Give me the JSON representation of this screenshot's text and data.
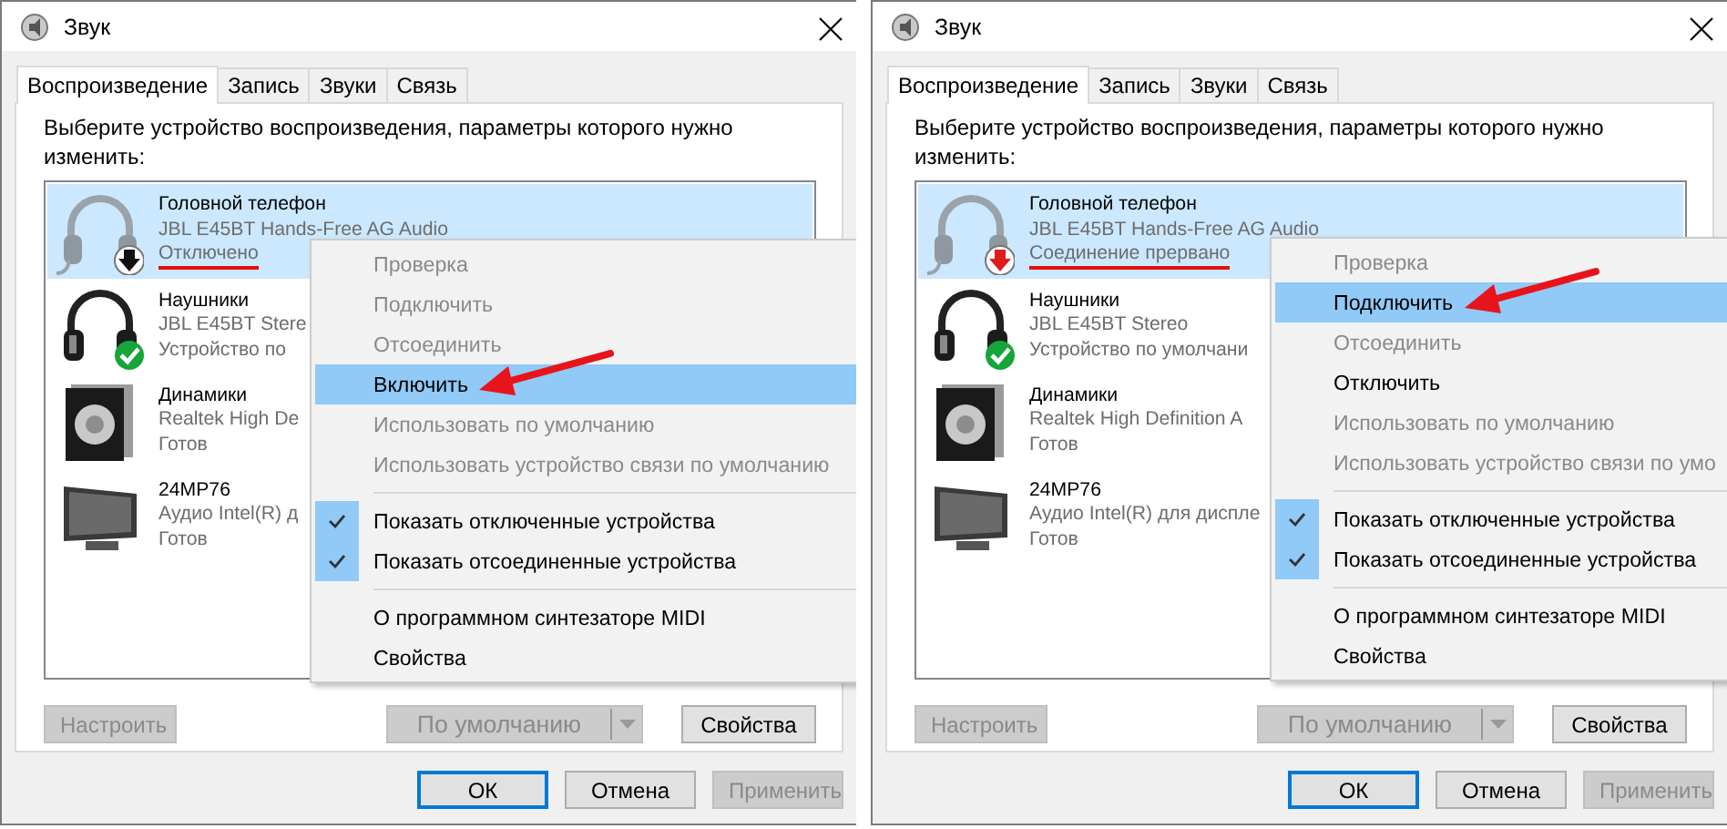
{
  "panels": [
    {
      "window": {
        "title": "Звук"
      },
      "tabs": [
        {
          "label": "Воспроизведение",
          "selected": true
        },
        {
          "label": "Запись",
          "selected": false
        },
        {
          "label": "Звуки",
          "selected": false
        },
        {
          "label": "Связь",
          "selected": false
        }
      ],
      "instruction": "Выберите устройство воспроизведения, параметры которого нужно изменить:",
      "devices": [
        {
          "kind": "off",
          "name": "Головной телефон",
          "driver": "JBL E45BT Hands-Free AG Audio",
          "status": "Отключено",
          "selected": true,
          "underlined": true
        },
        {
          "kind": "default",
          "name": "Наушники",
          "driver": "JBL E45BT Stere",
          "status": "Устройство по",
          "selected": false,
          "underlined": false
        },
        {
          "kind": "ready",
          "name": "Динамики",
          "driver": "Realtek High De",
          "status": "Готов",
          "selected": false,
          "underlined": false
        },
        {
          "kind": "ready",
          "name": "24MP76",
          "driver": "Аудио Intel(R) д",
          "status": "Готов",
          "selected": false,
          "underlined": false
        }
      ],
      "menu": [
        {
          "kind": "item",
          "label": "Проверка",
          "disabled": true,
          "selected": false,
          "checked": false,
          "pointed": false
        },
        {
          "kind": "item",
          "label": "Подключить",
          "disabled": true,
          "selected": false,
          "checked": false,
          "pointed": false
        },
        {
          "kind": "item",
          "label": "Отсоединить",
          "disabled": true,
          "selected": false,
          "checked": false,
          "pointed": false
        },
        {
          "kind": "item",
          "label": "Включить",
          "disabled": false,
          "selected": true,
          "checked": false,
          "pointed": true
        },
        {
          "kind": "item",
          "label": "Использовать по умолчанию",
          "disabled": true,
          "selected": false,
          "checked": false,
          "pointed": false
        },
        {
          "kind": "item",
          "label": "Использовать устройство связи по умолчанию",
          "disabled": true,
          "selected": false,
          "checked": false,
          "pointed": false
        },
        {
          "kind": "separator"
        },
        {
          "kind": "item",
          "label": "Показать отключенные устройства",
          "disabled": false,
          "selected": false,
          "checked": true,
          "pointed": false
        },
        {
          "kind": "item",
          "label": "Показать отсоединенные устройства",
          "disabled": false,
          "selected": false,
          "checked": true,
          "pointed": false
        },
        {
          "kind": "separator"
        },
        {
          "kind": "item",
          "label": "О программном синтезаторе MIDI",
          "disabled": false,
          "selected": false,
          "checked": false,
          "pointed": false
        },
        {
          "kind": "item",
          "label": "Свойства",
          "disabled": false,
          "selected": false,
          "checked": false,
          "pointed": false
        }
      ],
      "buttons": [
        {
          "kind": "plain",
          "label": "Настроить",
          "disabled": true
        },
        {
          "kind": "split",
          "label": "По умолчанию",
          "disabled": true
        },
        {
          "kind": "plain",
          "label": "Свойства",
          "disabled": false
        }
      ],
      "dialog_buttons": [
        {
          "label": "ОК",
          "focused": true,
          "disabled": false
        },
        {
          "label": "Отмена",
          "focused": false,
          "disabled": false
        },
        {
          "label": "Применить",
          "focused": false,
          "disabled": true
        }
      ]
    },
    {
      "window": {
        "title": "Звук"
      },
      "tabs": [
        {
          "label": "Воспроизведение",
          "selected": true
        },
        {
          "label": "Запись",
          "selected": false
        },
        {
          "label": "Звуки",
          "selected": false
        },
        {
          "label": "Связь",
          "selected": false
        }
      ],
      "instruction": "Выберите устройство воспроизведения, параметры которого нужно изменить:",
      "devices": [
        {
          "kind": "lost",
          "name": "Головной телефон",
          "driver": "JBL E45BT Hands-Free AG Audio",
          "status": "Соединение прервано",
          "selected": true,
          "underlined": true
        },
        {
          "kind": "default",
          "name": "Наушники",
          "driver": "JBL E45BT Stereo",
          "status": "Устройство по умолчани",
          "selected": false,
          "underlined": false
        },
        {
          "kind": "ready",
          "name": "Динамики",
          "driver": "Realtek High Definition A",
          "status": "Готов",
          "selected": false,
          "underlined": false
        },
        {
          "kind": "ready",
          "name": "24MP76",
          "driver": "Аудио Intel(R) для диспле",
          "status": "Готов",
          "selected": false,
          "underlined": false
        }
      ],
      "menu": [
        {
          "kind": "item",
          "label": "Проверка",
          "disabled": true,
          "selected": false,
          "checked": false,
          "pointed": false
        },
        {
          "kind": "item",
          "label": "Подключить",
          "disabled": false,
          "selected": true,
          "checked": false,
          "pointed": true
        },
        {
          "kind": "item",
          "label": "Отсоединить",
          "disabled": true,
          "selected": false,
          "checked": false,
          "pointed": false
        },
        {
          "kind": "item",
          "label": "Отключить",
          "disabled": false,
          "selected": false,
          "checked": false,
          "pointed": false
        },
        {
          "kind": "item",
          "label": "Использовать по умолчанию",
          "disabled": true,
          "selected": false,
          "checked": false,
          "pointed": false
        },
        {
          "kind": "item",
          "label": "Использовать устройство связи по умо",
          "disabled": true,
          "selected": false,
          "checked": false,
          "pointed": false
        },
        {
          "kind": "separator"
        },
        {
          "kind": "item",
          "label": "Показать отключенные устройства",
          "disabled": false,
          "selected": false,
          "checked": true,
          "pointed": false
        },
        {
          "kind": "item",
          "label": "Показать отсоединенные устройства",
          "disabled": false,
          "selected": false,
          "checked": true,
          "pointed": false
        },
        {
          "kind": "separator"
        },
        {
          "kind": "item",
          "label": "О программном синтезаторе MIDI",
          "disabled": false,
          "selected": false,
          "checked": false,
          "pointed": false
        },
        {
          "kind": "item",
          "label": "Свойства",
          "disabled": false,
          "selected": false,
          "checked": false,
          "pointed": false
        }
      ],
      "buttons": [
        {
          "kind": "plain",
          "label": "Настроить",
          "disabled": true
        },
        {
          "kind": "split",
          "label": "По умолчанию",
          "disabled": true
        },
        {
          "kind": "plain",
          "label": "Свойства",
          "disabled": false
        }
      ],
      "dialog_buttons": [
        {
          "label": "ОК",
          "focused": true,
          "disabled": false
        },
        {
          "label": "Отмена",
          "focused": false,
          "disabled": false
        },
        {
          "label": "Применить",
          "focused": false,
          "disabled": true
        }
      ]
    }
  ]
}
